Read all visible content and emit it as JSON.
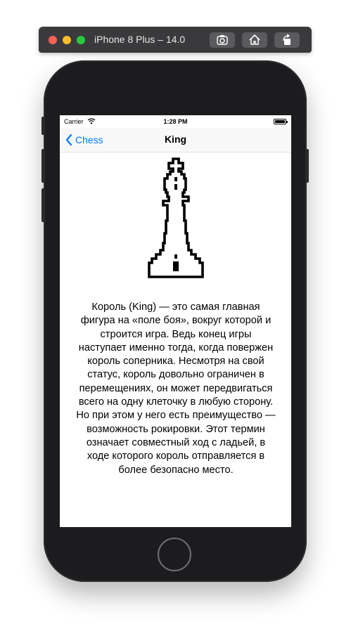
{
  "simulator": {
    "title": "iPhone 8 Plus – 14.0",
    "toolbar": {
      "screenshot_icon": "camera-icon",
      "home_icon": "home-icon",
      "rotate_icon": "rotate-icon"
    }
  },
  "status_bar": {
    "carrier": "Carrier",
    "time": "1:28 PM"
  },
  "nav": {
    "back_label": "Chess",
    "title": "King"
  },
  "content": {
    "image_icon": "chess-king-icon",
    "description": "Король (King) — это самая главная фигура на «поле боя», вокруг которой и строится игра. Ведь конец игры наступает именно тогда, когда повержен король соперника. Несмотря на свой статус, король довольно ограничен в перемещениях, он может передвигаться всего на одну клеточку в любую сторону. Но при этом у него есть преимущество — возможность рокировки. Этот термин означает совместный ход с ладьей, в ходе которого король отправляется в более безопасно место."
  },
  "colors": {
    "accent": "#007aff",
    "phone_body": "#1c1c1e",
    "sim_bar": "#3a3a3c"
  }
}
